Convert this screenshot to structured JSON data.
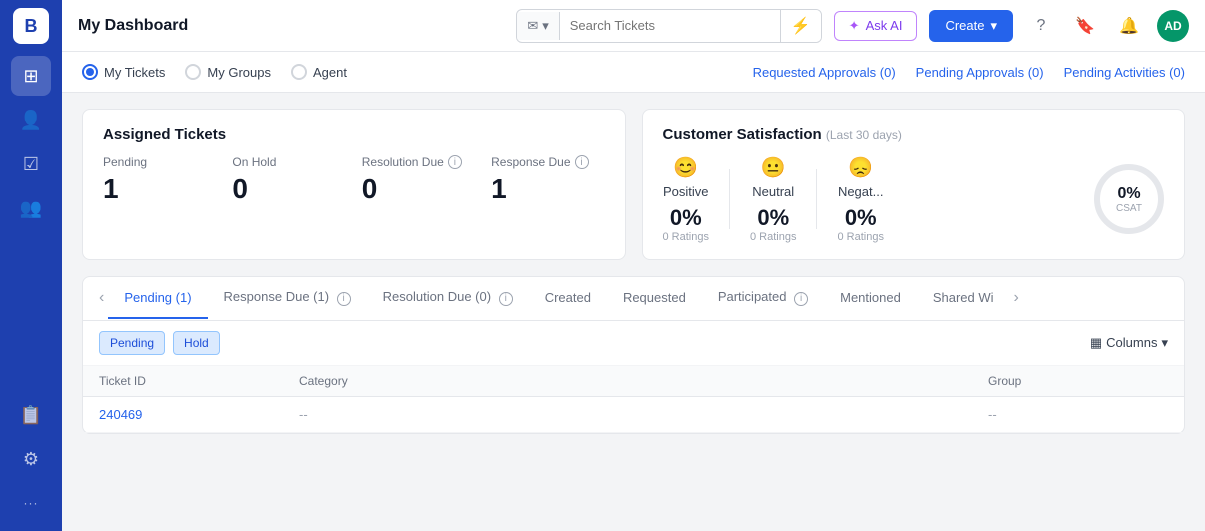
{
  "app": {
    "logo": "B",
    "title": "My Dashboard"
  },
  "sidebar": {
    "icons": [
      {
        "name": "home-icon",
        "symbol": "⊞",
        "active": true
      },
      {
        "name": "users-icon",
        "symbol": "👤",
        "active": false
      },
      {
        "name": "tickets-icon",
        "symbol": "☑",
        "active": false
      },
      {
        "name": "contacts-icon",
        "symbol": "👥",
        "active": false
      },
      {
        "name": "reports-icon",
        "symbol": "📋",
        "active": false
      },
      {
        "name": "settings-icon",
        "symbol": "⚙",
        "active": false
      },
      {
        "name": "more-icon",
        "symbol": "•••",
        "active": false
      }
    ]
  },
  "topbar": {
    "title": "My Dashboard",
    "search_placeholder": "Search Tickets",
    "search_type": "✉",
    "filter_icon": "⚡",
    "ask_ai_label": "Ask AI",
    "create_label": "Create",
    "help_icon": "?",
    "bookmark_icon": "🔖",
    "bell_icon": "🔔",
    "avatar_text": "AD"
  },
  "subnav": {
    "radio_options": [
      {
        "label": "My Tickets",
        "value": "my_tickets",
        "selected": true
      },
      {
        "label": "My Groups",
        "value": "my_groups",
        "selected": false
      },
      {
        "label": "Agent",
        "value": "agent",
        "selected": false
      }
    ],
    "approval_links": [
      {
        "label": "Requested Approvals (0)"
      },
      {
        "label": "Pending Approvals (0)"
      },
      {
        "label": "Pending Activities (0)"
      }
    ]
  },
  "assigned_tickets": {
    "title": "Assigned Tickets",
    "stats": [
      {
        "label": "Pending",
        "value": "1",
        "has_info": false
      },
      {
        "label": "On Hold",
        "value": "0",
        "has_info": false
      },
      {
        "label": "Resolution Due",
        "value": "0",
        "has_info": true
      },
      {
        "label": "Response Due",
        "value": "1",
        "has_info": true
      }
    ]
  },
  "csat": {
    "title": "Customer Satisfaction",
    "subtitle": "(Last 30 days)",
    "items": [
      {
        "icon": "😊",
        "label": "Positive",
        "pct": "0%",
        "ratings": "0 Ratings"
      },
      {
        "icon": "😐",
        "label": "Neutral",
        "pct": "0%",
        "ratings": "0 Ratings"
      },
      {
        "icon": "😞",
        "label": "Negat...",
        "pct": "0%",
        "ratings": "0 Ratings"
      }
    ],
    "circle_pct": "0%",
    "circle_label": "CSAT"
  },
  "tabs": {
    "items": [
      {
        "label": "Pending (1)",
        "active": true,
        "has_info": false
      },
      {
        "label": "Response Due (1)",
        "active": false,
        "has_info": true
      },
      {
        "label": "Resolution Due (0)",
        "active": false,
        "has_info": true
      },
      {
        "label": "Created",
        "active": false,
        "has_info": false
      },
      {
        "label": "Requested",
        "active": false,
        "has_info": false
      },
      {
        "label": "Participated",
        "active": false,
        "has_info": true
      },
      {
        "label": "Mentioned",
        "active": false,
        "has_info": false
      },
      {
        "label": "Shared Wi",
        "active": false,
        "has_info": false
      }
    ],
    "filters": [
      {
        "label": "Pending",
        "style": "blue"
      },
      {
        "label": "Hold",
        "style": "blue"
      }
    ],
    "columns_label": "Columns"
  },
  "table": {
    "headers": [
      "Ticket ID",
      "Category",
      "Group"
    ],
    "rows": [
      {
        "ticket_id": "240469",
        "category": "--",
        "group": "--"
      }
    ]
  }
}
